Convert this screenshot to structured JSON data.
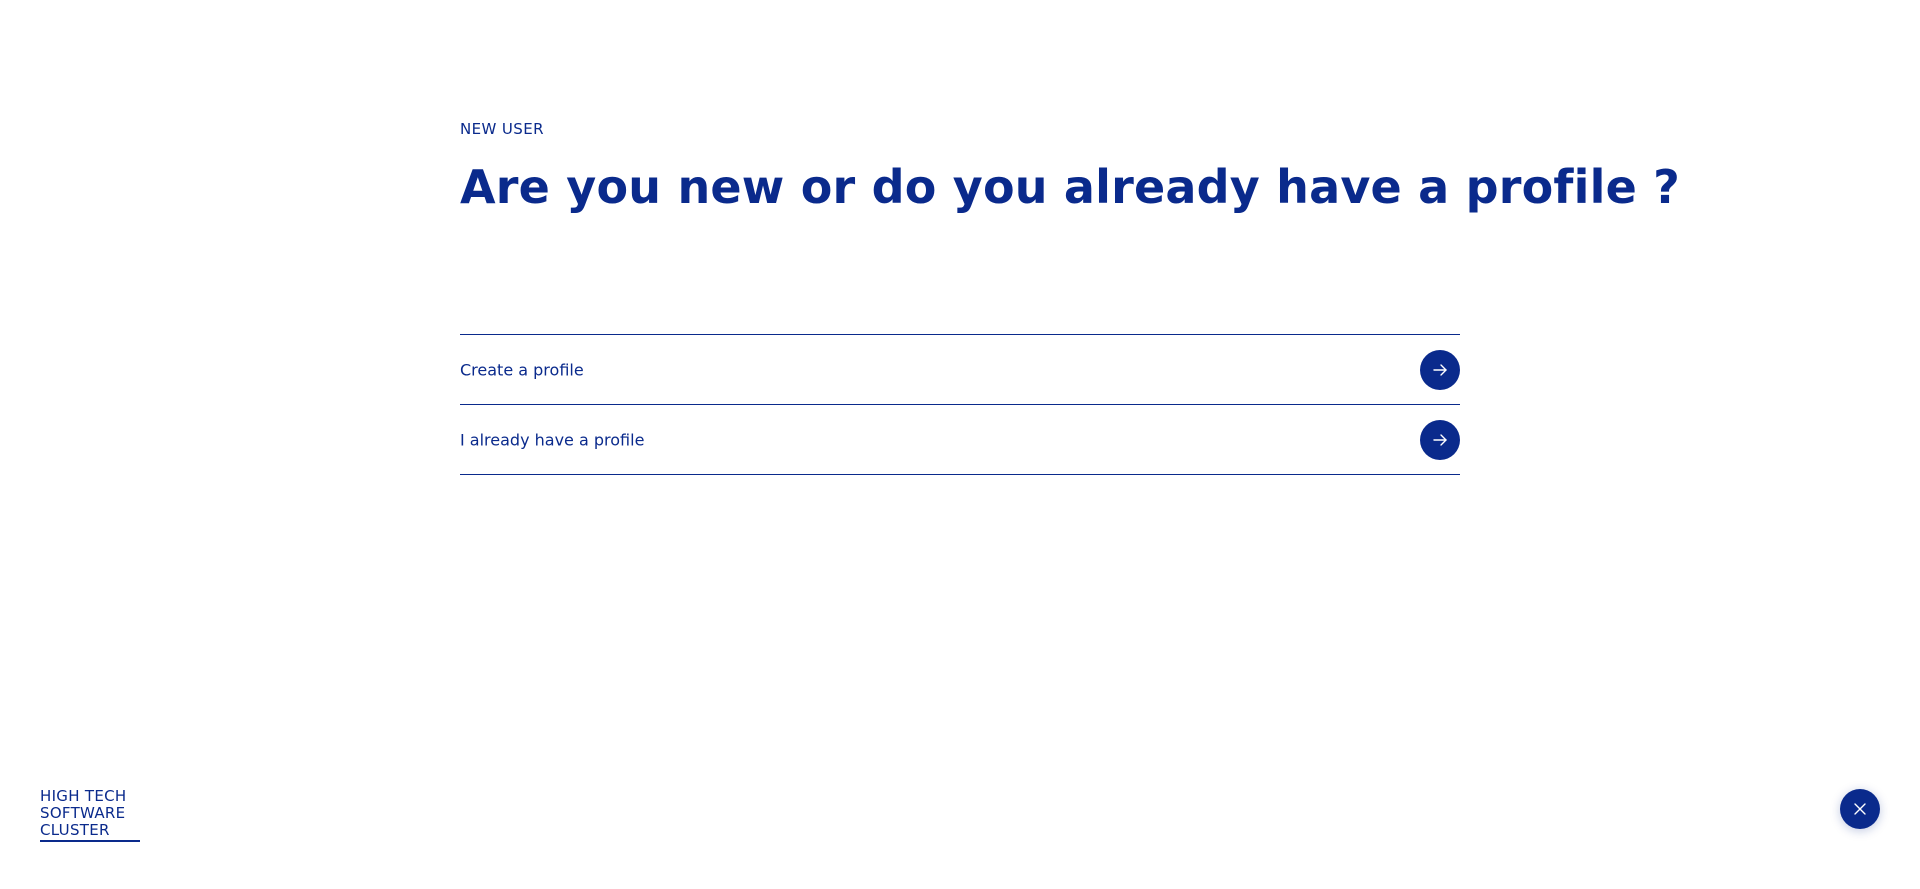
{
  "eyebrow": "NEW USER",
  "heading": "Are you new or do you already have a profile ?",
  "options": [
    {
      "label": "Create a profile",
      "icon": "arrow-right-icon"
    },
    {
      "label": "I already have a profile",
      "icon": "arrow-right-icon"
    }
  ],
  "logo": {
    "lines": [
      "HIGH TECH",
      "SOFTWARE",
      "CLUSTER"
    ]
  },
  "close_button": {
    "icon": "close-icon"
  },
  "colors": {
    "brand": "#0a2a8c",
    "background": "#ffffff"
  }
}
